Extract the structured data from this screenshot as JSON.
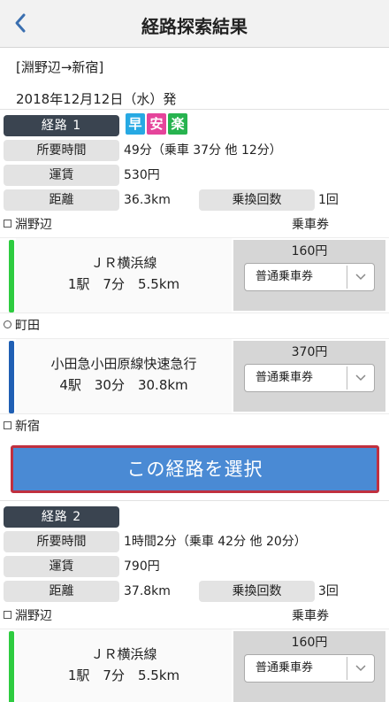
{
  "header": {
    "title": "経路探索結果",
    "back_icon": "chevron-left-icon"
  },
  "summary": {
    "route": "[淵野辺→新宿]",
    "datetime": "2018年12月12日（水）発"
  },
  "badges": [
    {
      "text": "早",
      "color": "#27a9e3"
    },
    {
      "text": "安",
      "color": "#e5449b"
    },
    {
      "text": "楽",
      "color": "#27b34f"
    }
  ],
  "routes": [
    {
      "label": "経路 1",
      "time_label": "所要時間",
      "time_value": "49分（乗車 37分 他 12分）",
      "fare_label": "運賃",
      "fare_value": "530円",
      "distance_label": "距離",
      "distance_value": "36.3km",
      "transfer_label": "乗換回数",
      "transfer_value": "1回",
      "ticket_header": "乗車券",
      "stations": [
        "淵野辺",
        "町田",
        "新宿"
      ],
      "segments": [
        {
          "line": "ＪＲ横浜線",
          "detail": "1駅　7分　5.5km",
          "fare": "160円",
          "ticket": "普通乗車券",
          "color": "#2ecc40"
        },
        {
          "line": "小田急小田原線快速急行",
          "detail": "4駅　30分　30.8km",
          "fare": "370円",
          "ticket": "普通乗車券",
          "color": "#1f5fb4"
        }
      ]
    },
    {
      "label": "経路 2",
      "time_label": "所要時間",
      "time_value": "1時間2分（乗車 42分 他 20分）",
      "fare_label": "運賃",
      "fare_value": "790円",
      "distance_label": "距離",
      "distance_value": "37.8km",
      "transfer_label": "乗換回数",
      "transfer_value": "3回",
      "ticket_header": "乗車券",
      "stations": [
        "淵野辺"
      ],
      "segments": [
        {
          "line": "ＪＲ横浜線",
          "detail": "1駅　7分　5.5km",
          "fare": "160円",
          "ticket": "普通乗車券",
          "color": "#2ecc40"
        }
      ]
    }
  ],
  "select_button": "この経路を選択"
}
